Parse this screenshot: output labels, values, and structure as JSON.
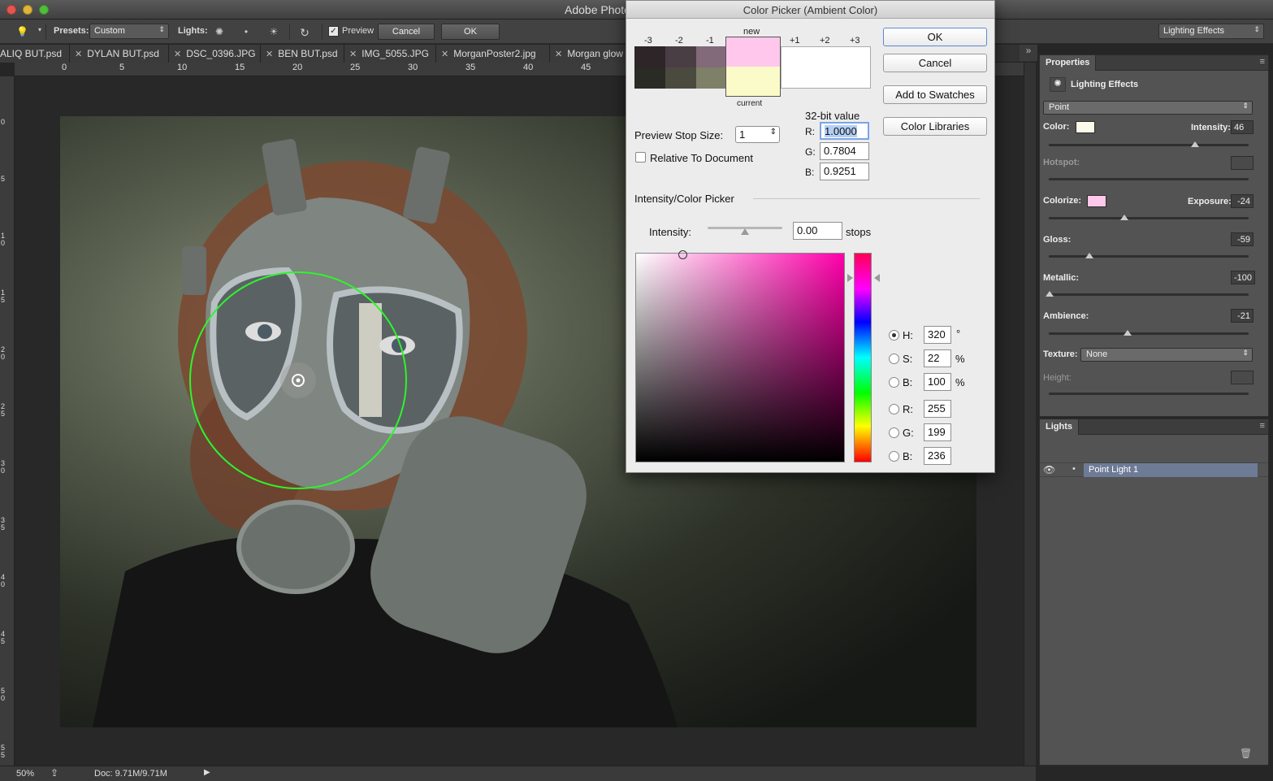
{
  "window": {
    "app_title": "Adobe Photo"
  },
  "options_bar": {
    "presets_label": "Presets:",
    "presets_value": "Custom",
    "lights_label": "Lights:",
    "preview_label": "Preview",
    "cancel_label": "Cancel",
    "ok_label": "OK",
    "workspace_value": "Lighting Effects"
  },
  "tabs": [
    {
      "label": "ALIQ BUT.psd"
    },
    {
      "label": "DYLAN BUT.psd"
    },
    {
      "label": "DSC_0396.JPG"
    },
    {
      "label": "BEN BUT.psd"
    },
    {
      "label": "IMG_5055.JPG"
    },
    {
      "label": "MorganPoster2.jpg"
    },
    {
      "label": "Morgan glow"
    }
  ],
  "ruler_top": [
    "0",
    "5",
    "10",
    "15",
    "20",
    "25",
    "30",
    "35",
    "40",
    "45"
  ],
  "ruler_left": [
    "0",
    "5",
    "1 0",
    "1 5",
    "2 0",
    "2 5",
    "3 0",
    "3 5",
    "4 0",
    "4 5",
    "5 0",
    "5 5"
  ],
  "status": {
    "zoom": "50%",
    "doc": "Doc: 9.71M/9.71M"
  },
  "color_picker": {
    "title": "Color Picker (Ambient Color)",
    "ok_label": "OK",
    "cancel_label": "Cancel",
    "add_swatches_label": "Add to Swatches",
    "color_libraries_label": "Color Libraries",
    "stops": [
      "-3",
      "-2",
      "-1",
      "+1",
      "+2",
      "+3"
    ],
    "new_label": "new",
    "current_label": "current",
    "new_color": "#ffc7ec",
    "current_color": "#fbfbc9",
    "bit_label": "32-bit value",
    "preview_stop_label": "Preview Stop Size:",
    "preview_stop_value": "1",
    "relative_label": "Relative To Document",
    "r_label": "R:",
    "g_label": "G:",
    "b_label": "B:",
    "r32": "1.0000",
    "g32": "0.7804",
    "b32": "0.9251",
    "section_label": "Intensity/Color Picker",
    "intensity_label": "Intensity:",
    "intensity_value": "0.00",
    "stops_unit": "stops",
    "h_label": "H:",
    "s_label": "S:",
    "bh_label": "B:",
    "rr_label": "R:",
    "gg_label": "G:",
    "bb_label": "B:",
    "h_value": "320",
    "s_value": "22",
    "b_value": "100",
    "r_value": "255",
    "g_value": "199",
    "bb_value": "236",
    "deg": "°",
    "pct": "%"
  },
  "properties": {
    "tab_label": "Properties",
    "title": "Lighting Effects",
    "light_type": "Point",
    "color_label": "Color:",
    "color_swatch": "#fbfaea",
    "intensity_label": "Intensity:",
    "intensity_value": "46",
    "hotspot_label": "Hotspot:",
    "colorize_label": "Colorize:",
    "colorize_swatch": "#ffc7ec",
    "exposure_label": "Exposure:",
    "exposure_value": "-24",
    "gloss_label": "Gloss:",
    "gloss_value": "-59",
    "metallic_label": "Metallic:",
    "metallic_value": "-100",
    "ambience_label": "Ambience:",
    "ambience_value": "-21",
    "texture_label": "Texture:",
    "texture_value": "None",
    "height_label": "Height:"
  },
  "lights_panel": {
    "tab_label": "Lights",
    "item_label": "Point Light 1"
  }
}
